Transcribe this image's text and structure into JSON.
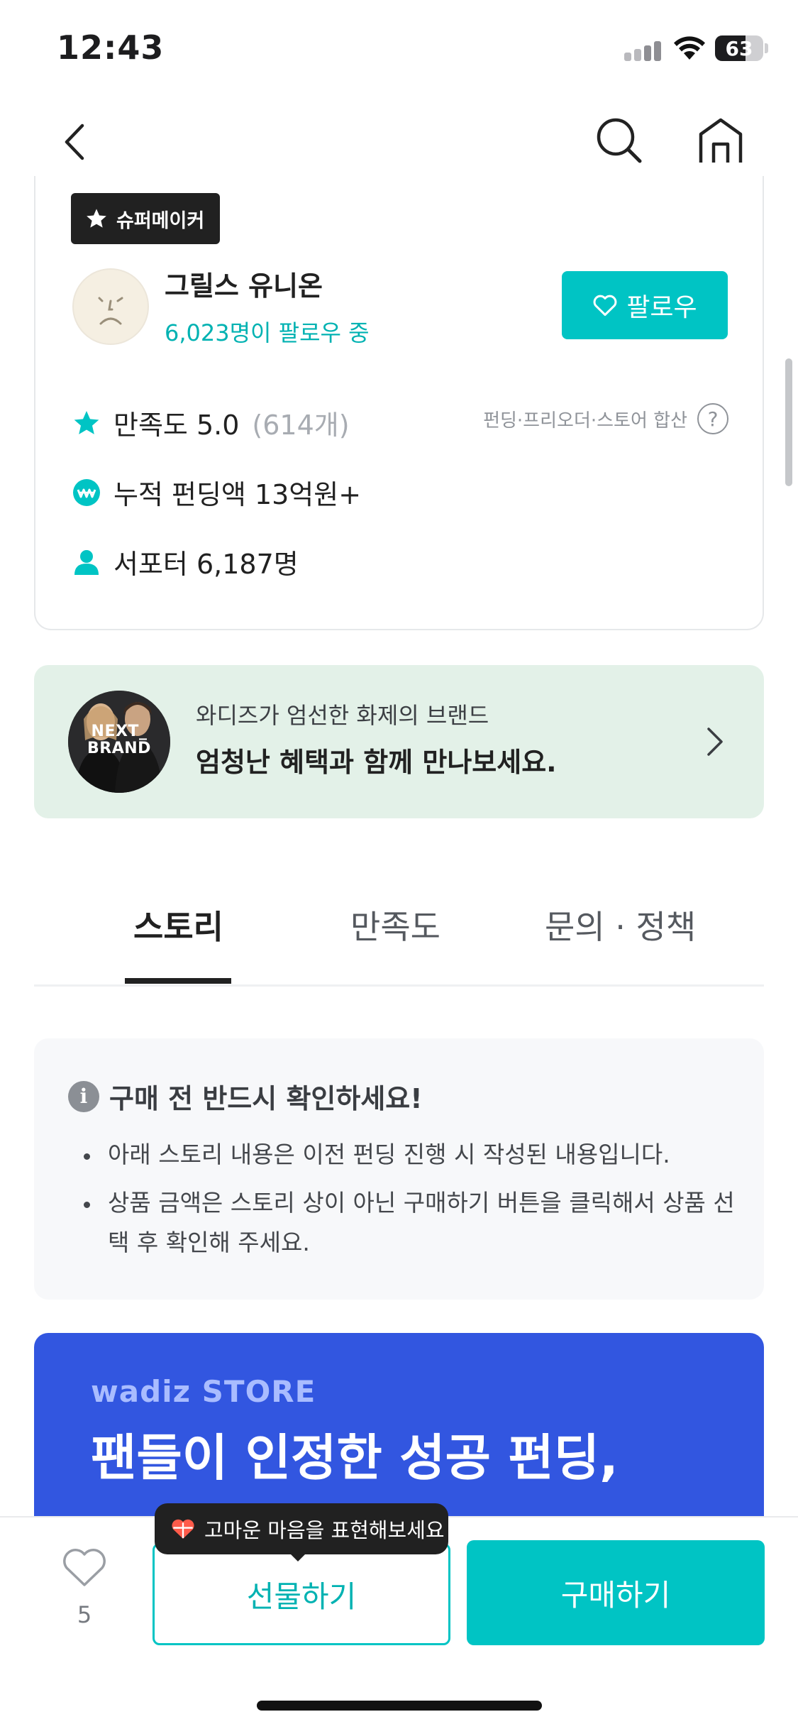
{
  "status_bar": {
    "time": "12:43",
    "battery": "63",
    "battery_level": 0.63
  },
  "nav": {
    "icons": [
      "back-chevron-icon",
      "search-icon",
      "home-icon"
    ]
  },
  "maker": {
    "badge_label": "슈퍼메이커",
    "name": "그릴스 유니온",
    "followers": "6,023명이 팔로우 중",
    "follow_label": "팔로우",
    "rating_label": "만족도 5.0",
    "rating_count": "(614개)",
    "rating_note": "펀딩·프리오더·스토어 합산",
    "help_symbol": "?",
    "funding_total": "누적 펀딩액 13억원+",
    "supporters": "서포터 6,187명",
    "accent_color": "#00c4c4"
  },
  "brand_banner": {
    "thumb_text_line1": "NEXT_",
    "thumb_text_line2": "BRAND",
    "subtitle": "와디즈가 엄선한 화제의 브랜드",
    "title": "엄청난 혜택과 함께 만나보세요."
  },
  "tabs": [
    {
      "label": "스토리",
      "active": true
    },
    {
      "label": "만족도",
      "active": false
    },
    {
      "label": "문의 · 정책",
      "active": false
    }
  ],
  "notice": {
    "icon_symbol": "i",
    "title": "구매 전 반드시 확인하세요!",
    "items": [
      "아래 스토리 내용은 이전 펀딩 진행 시 작성된 내용입니다.",
      "상품 금액은 스토리 상이 아닌 구매하기 버튼을 클릭해서 상품 선택 후 확인해 주세요."
    ]
  },
  "store_promo": {
    "logo": "wadiz STORE",
    "headline": "팬들이 인정한 성공 펀딩,"
  },
  "bottom_bar": {
    "wish_count": "5",
    "gift_label": "선물하기",
    "buy_label": "구매하기",
    "tooltip": "고마운 마음을 표현해보세요"
  }
}
